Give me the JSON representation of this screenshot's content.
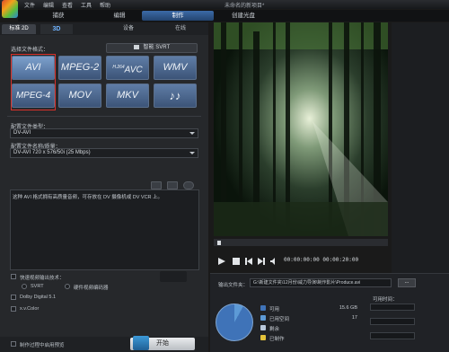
{
  "menu": [
    "文件",
    "编辑",
    "查看",
    "工具",
    "帮助"
  ],
  "window_title": "未命名的新项目*",
  "modes": [
    "捕获",
    "编辑",
    "制作",
    "创建光盘"
  ],
  "subtabs": [
    "标准 2D",
    "3D",
    "设备",
    "在线"
  ],
  "format_section": {
    "title": "选择文件格式：",
    "smart_svrt": "智能 SVRT",
    "buttons": [
      "AVI",
      "MPEG-2",
      "AVC",
      "WMV",
      "MPEG-4",
      "MOV",
      "MKV",
      "♪♪"
    ],
    "avc_prefix": "H.264",
    "selected": "AVI"
  },
  "profile_type": {
    "label": "配置文件类型：",
    "value": "DV-AVI"
  },
  "profile_quality": {
    "label": "配置文件名称/质量：",
    "value": "DV-AVI 720 x 576/50i (25 Mbps)"
  },
  "description": "这种 AVI 格式拥有高质量音频，可存放在 DV 摄像机或 DV VCR 上。",
  "options": {
    "fast_render": "快速视频输出技术：",
    "svrt": "SVRT",
    "hw_encoder": "硬件视频编码器",
    "dolby": "Dolby Digital 5.1",
    "xvcolor": "x.v.Color",
    "preview_while_producing": "制作过程中启用预览"
  },
  "start_button": "开始",
  "player": {
    "timecode": "00:00:00:00   00:00:20:00"
  },
  "output": {
    "label": "输出文件夹：",
    "path": "G:\\新建文件夹\\12月份\\威力导演\\制作影片\\Produce.avi",
    "browse": "..."
  },
  "disk": {
    "legend": [
      {
        "label": "可用",
        "value": "15.6 GB",
        "color": "#3f73b8"
      },
      {
        "label": "已用空间",
        "value": "17",
        "color": "#5d9ad6"
      },
      {
        "label": "剩余",
        "value": "",
        "color": "#b9c8da"
      },
      {
        "label": "已制作",
        "value": "",
        "color": "#e3c23a"
      }
    ],
    "time_label": "可用时间："
  },
  "colors": {
    "accent": "#3b6aa8",
    "selection_outline": "#d9312b"
  }
}
